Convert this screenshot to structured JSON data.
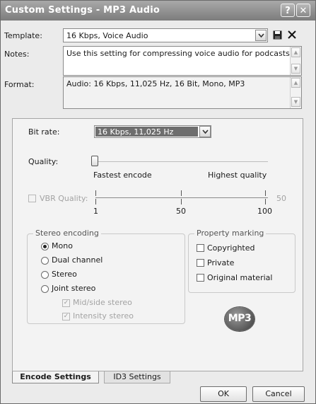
{
  "window": {
    "title": "Custom Settings - MP3 Audio",
    "help_glyph": "?",
    "close_glyph": "✕"
  },
  "header": {
    "template_label": "Template:",
    "template_value": "16 Kbps, Voice Audio",
    "save_icon": "floppy-disk-icon",
    "delete_icon": "x-delete-icon",
    "notes_label": "Notes:",
    "notes_value": "Use this setting for compressing voice audio for podcasts.",
    "format_label": "Format:",
    "format_value": "Audio: 16 Kbps, 11,025 Hz, 16 Bit, Mono, MP3"
  },
  "encode": {
    "bitrate_label": "Bit rate:",
    "bitrate_value": "16 Kbps, 11,025 Hz",
    "quality_label": "Quality:",
    "quality_level": 0,
    "quality_min_label": "Fastest encode",
    "quality_max_label": "Highest quality",
    "vbr_label": "VBR Quality:",
    "vbr_value": "50",
    "vbr_ticks": [
      "1",
      "50",
      "100"
    ],
    "stereo_caption": "Stereo encoding",
    "stereo_options": [
      "Mono",
      "Dual channel",
      "Stereo",
      "Joint stereo"
    ],
    "stereo_selected": "Mono",
    "joint_sub": [
      "Mid/side stereo",
      "Intensity stereo"
    ],
    "property_caption": "Property marking",
    "property_options": [
      "Copyrighted",
      "Private",
      "Original material"
    ],
    "mp3_logo": "MP3"
  },
  "tabs": [
    "Encode Settings",
    "ID3 Settings"
  ],
  "footer": {
    "ok": "OK",
    "cancel": "Cancel"
  },
  "colors": {
    "title_bar": "#8c8c8c",
    "selected_bitrate": "#6e6e6e",
    "panel": "#f3f3f3"
  }
}
